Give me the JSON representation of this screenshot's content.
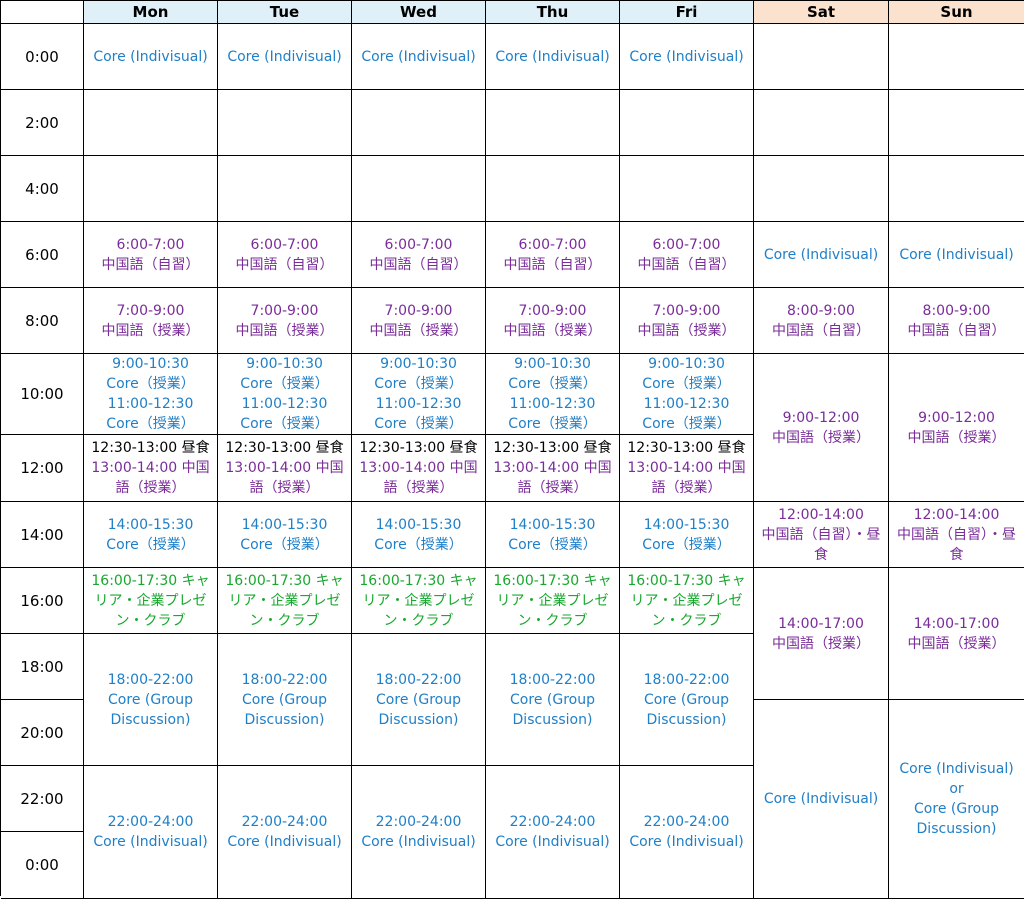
{
  "header": {
    "corner": "",
    "days": [
      "Mon",
      "Tue",
      "Wed",
      "Thu",
      "Fri",
      "Sat",
      "Sun"
    ]
  },
  "times": [
    "0:00",
    "2:00",
    "4:00",
    "6:00",
    "8:00",
    "10:00",
    "12:00",
    "14:00",
    "16:00",
    "18:00",
    "20:00",
    "22:00",
    "0:00"
  ],
  "colors": {
    "core": "#1f7fc7",
    "chinese": "#7a2c99",
    "career": "#18a82e",
    "lunch": "#000000",
    "weekday_header": "#dff0f8",
    "weekend_header": "#fbe2cf"
  },
  "weekday": {
    "r0000": "Core (Indivisual)",
    "r0600": [
      "6:00-7:00",
      "中国語（自習）"
    ],
    "r0800": [
      "7:00-9:00",
      "中国語（授業）"
    ],
    "r1000": [
      "9:00-10:30",
      "Core（授業）",
      "11:00-12:30",
      "Core（授業）"
    ],
    "r1200_lunch": "12:30-13:00 昼食",
    "r1200_class": "13:00-14:00 中国語（授業）",
    "r1400": [
      "14:00-15:30",
      "Core（授業）"
    ],
    "r1600": "16:00-17:30 キャリア・企業プレゼン・クラブ",
    "r1800": [
      "18:00-22:00",
      "Core (Group",
      "Discussion)"
    ],
    "r2200": [
      "22:00-24:00",
      "Core (Indivisual)"
    ]
  },
  "saturday": {
    "r0600": "Core (Indivisual)",
    "r0800": [
      "8:00-9:00",
      "中国語（自習）"
    ],
    "r1000": [
      "9:00-12:00",
      "中国語（授業）"
    ],
    "r1400": [
      "12:00-14:00",
      "中国語（自習）・昼食"
    ],
    "r1600": [
      "14:00-17:00",
      "中国語（授業）"
    ],
    "r2000": "Core (Indivisual)"
  },
  "sunday": {
    "r0600": "Core (Indivisual)",
    "r0800": [
      "8:00-9:00",
      "中国語（自習）"
    ],
    "r1000": [
      "9:00-12:00",
      "中国語（授業）"
    ],
    "r1400": [
      "12:00-14:00",
      "中国語（自習）・昼食"
    ],
    "r1600": [
      "14:00-17:00",
      "中国語（授業）"
    ],
    "r2000": [
      "Core (Indivisual)",
      "or",
      "Core (Group",
      "Discussion)"
    ]
  }
}
